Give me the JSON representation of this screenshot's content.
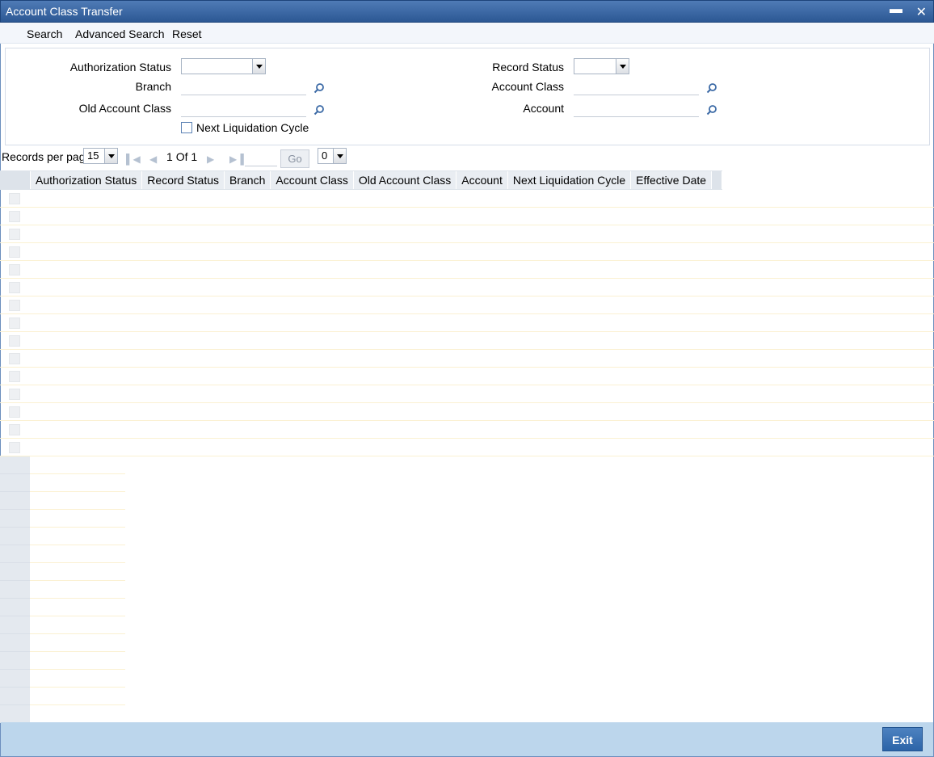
{
  "window": {
    "title": "Account Class Transfer"
  },
  "toolbar": {
    "search": "Search",
    "advanced_search": "Advanced Search",
    "reset": "Reset"
  },
  "criteria": {
    "authorization_status_label": "Authorization Status",
    "branch_label": "Branch",
    "old_account_class_label": "Old Account Class",
    "next_liquidation_cycle_label": "Next Liquidation Cycle",
    "record_status_label": "Record Status",
    "account_class_label": "Account Class",
    "account_label": "Account"
  },
  "pager": {
    "records_per_page_label": "Records per page",
    "records_per_page_value": "15",
    "page_current": "1",
    "page_of": "Of",
    "page_total": "1",
    "go_label": "Go",
    "option_value": "0"
  },
  "grid": {
    "columns": [
      "Authorization Status",
      "Record Status",
      "Branch",
      "Account Class",
      "Old Account Class",
      "Account",
      "Next Liquidation Cycle",
      "Effective Date"
    ]
  },
  "footer": {
    "exit_label": "Exit"
  },
  "colors": {
    "titlebar": "#2c5894",
    "footer": "#bcd6ec",
    "exit_button": "#2c64a8"
  }
}
